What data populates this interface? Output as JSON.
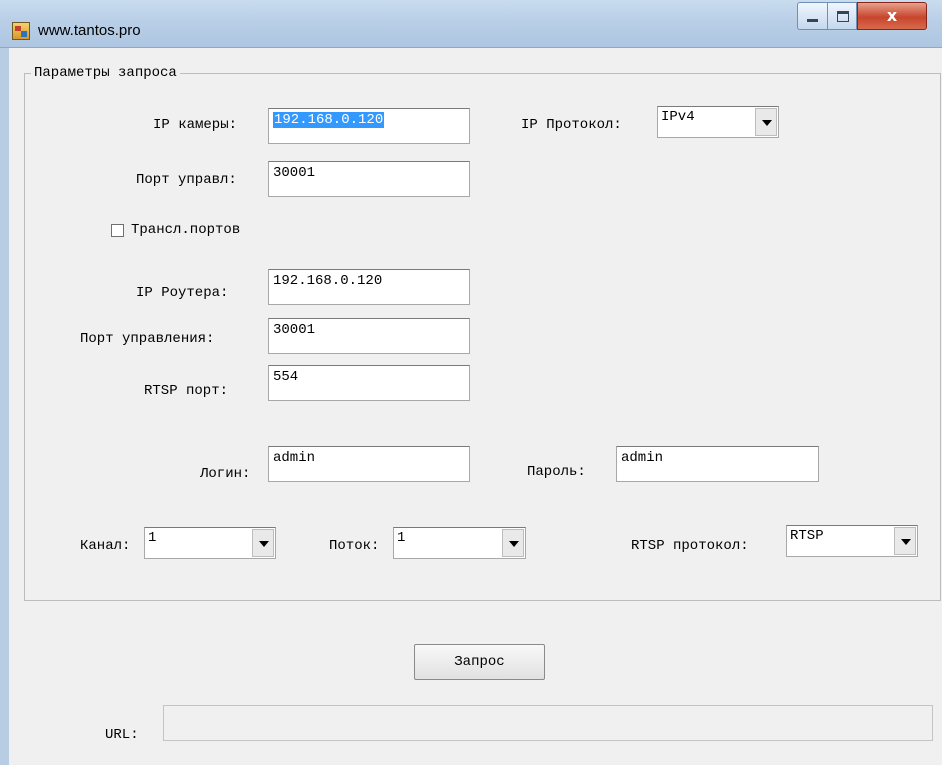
{
  "window": {
    "title": "www.tantos.pro",
    "app_icon": "app-icon",
    "close_glyph": "x"
  },
  "group": {
    "title": "Параметры запроса",
    "ip_camera": {
      "label": "IP камеры:",
      "value": "192.168.0.120"
    },
    "ip_protocol": {
      "label": "IP Протокол:",
      "value": "IPv4"
    },
    "control_port": {
      "label": "Порт управл:",
      "value": "30001"
    },
    "port_forwarding": {
      "label": "Трансл.портов",
      "checked": false
    },
    "router_ip": {
      "label": "IP Роутера:",
      "value": "192.168.0.120"
    },
    "management_port": {
      "label": "Порт управления:",
      "value": "30001"
    },
    "rtsp_port": {
      "label": "RTSP порт:",
      "value": "554"
    },
    "login": {
      "label": "Логин:",
      "value": "admin"
    },
    "password": {
      "label": "Пароль:",
      "value": "admin"
    },
    "channel": {
      "label": "Канал:",
      "value": "1"
    },
    "stream": {
      "label": "Поток:",
      "value": "1"
    },
    "rtsp_protocol": {
      "label": "RTSP протокол:",
      "value": "RTSP"
    }
  },
  "request_button": {
    "label": "Запрос"
  },
  "url": {
    "label": "URL:",
    "value": ""
  },
  "colors": {
    "selection": "#3399ff",
    "window_bg": "#f0f0f0",
    "close_button": "#c8452e"
  }
}
